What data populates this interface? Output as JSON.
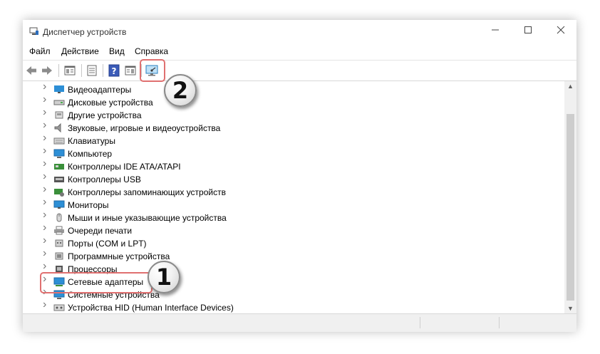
{
  "window": {
    "title": "Диспетчер устройств"
  },
  "menu": [
    "Файл",
    "Действие",
    "Вид",
    "Справка"
  ],
  "tree": [
    {
      "label": "Видеоадаптеры",
      "icon": "display-adapter-icon"
    },
    {
      "label": "Дисковые устройства",
      "icon": "disk-drive-icon"
    },
    {
      "label": "Другие устройства",
      "icon": "other-device-icon"
    },
    {
      "label": "Звуковые, игровые и видеоустройства",
      "icon": "speaker-icon"
    },
    {
      "label": "Клавиатуры",
      "icon": "keyboard-icon"
    },
    {
      "label": "Компьютер",
      "icon": "computer-icon"
    },
    {
      "label": "Контроллеры IDE ATA/ATAPI",
      "icon": "ide-controller-icon"
    },
    {
      "label": "Контроллеры USB",
      "icon": "usb-controller-icon"
    },
    {
      "label": "Контроллеры запоминающих устройств",
      "icon": "storage-controller-icon"
    },
    {
      "label": "Мониторы",
      "icon": "monitor-icon"
    },
    {
      "label": "Мыши и иные указывающие устройства",
      "icon": "mouse-icon"
    },
    {
      "label": "Очереди печати",
      "icon": "printer-icon"
    },
    {
      "label": "Порты (COM и LPT)",
      "icon": "port-icon"
    },
    {
      "label": "Программные устройства",
      "icon": "software-device-icon"
    },
    {
      "label": "Процессоры",
      "icon": "processor-icon"
    },
    {
      "label": "Сетевые адаптеры",
      "icon": "network-adapter-icon"
    },
    {
      "label": "Системные устройства",
      "icon": "system-device-icon"
    },
    {
      "label": "Устройства HID (Human Interface Devices)",
      "icon": "hid-icon"
    }
  ],
  "badges": {
    "first": "1",
    "second": "2"
  },
  "colors": {
    "callout_border": "#e07070",
    "accent": "#1a78c2"
  }
}
